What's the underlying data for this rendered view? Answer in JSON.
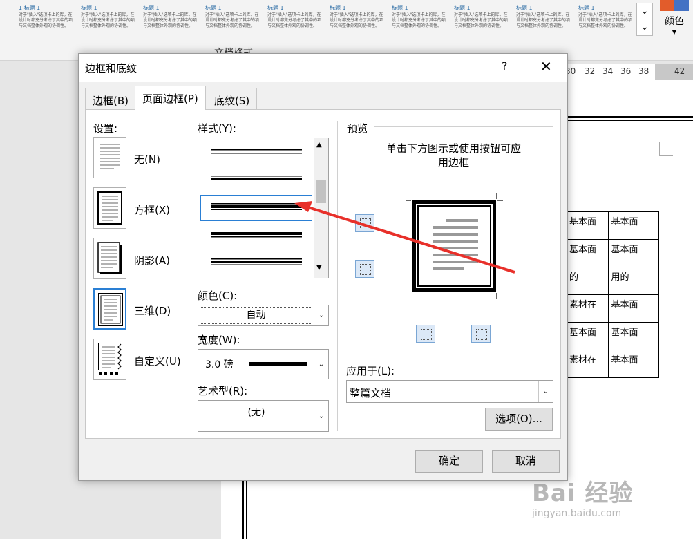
{
  "ribbon": {
    "gallery": [
      {
        "heading": "1  标题 1",
        "body": "对于\"插入\"选项卡上的库，在设计时都充分考虑了其中的项与文档整体外观的协调性。"
      },
      {
        "heading": "标题 1",
        "body": "对于\"插入\"选项卡上的库，在设计时都充分考虑了其中的项与文档整体外观的协调性。"
      },
      {
        "heading": "标题 1",
        "body": "对于\"插入\"选项卡上的库，在设计时都充分考虑了其中的项与文档整体外观的协调性。"
      },
      {
        "heading": "标题 1",
        "body": "对于\"插入\"选项卡上的库，在设计时都充分考虑了其中的项与文档整体外观的协调性。"
      },
      {
        "heading": "标题 1",
        "body": "对于\"插入\"选项卡上的库，在设计时都充分考虑了其中的项与文档整体外观的协调性。"
      },
      {
        "heading": "标题 1",
        "body": "对于\"插入\"选项卡上的库，在设计时都充分考虑了其中的项与文档整体外观的协调性。"
      },
      {
        "heading": "标题 1",
        "body": "对于\"插入\"选项卡上的库，在设计时都充分考虑了其中的项与文档整体外观的协调性。"
      },
      {
        "heading": "标题 1",
        "body": "对于\"插入\"选项卡上的库，在设计时都充分考虑了其中的项与文档整体外观的协调性。"
      },
      {
        "heading": "标题 1",
        "body": "对于\"插入\"选项卡上的库，在设计时都充分考虑了其中的项与文档整体外观的协调性。"
      },
      {
        "heading": "标题 1",
        "body": "对于\"插入\"选项卡上的库，在设计时都充分考虑了其中的项与文档整体外观的协调性。"
      }
    ],
    "group_label": "文档格式",
    "color_label": "颜色",
    "color_drop": "▼"
  },
  "ruler": {
    "ticks": [
      "30",
      "32",
      "34",
      "36",
      "38",
      "42"
    ]
  },
  "document": {
    "table": [
      [
        "基本面",
        "基本面"
      ],
      [
        "基本面",
        "基本面"
      ],
      [
        "的",
        "用的"
      ],
      [
        "素材在",
        "基本面"
      ],
      [
        "基本面",
        "基本面"
      ],
      [
        "素材在",
        "基本面"
      ]
    ]
  },
  "watermark": {
    "main": "Bai 经验",
    "sub": "jingyan.baidu.com"
  },
  "dialog": {
    "title": "边框和底纹",
    "help": "?",
    "close": "✕",
    "tabs": [
      "边框(B)",
      "页面边框(P)",
      "底纹(S)"
    ],
    "settings_label": "设置:",
    "settings": [
      "无(N)",
      "方框(X)",
      "阴影(A)",
      "三维(D)",
      "自定义(U)"
    ],
    "style_label": "样式(Y):",
    "color_label": "颜色(C):",
    "color_value": "自动",
    "width_label": "宽度(W):",
    "width_value": "3.0 磅",
    "art_label": "艺术型(R):",
    "art_value": "(无)",
    "preview_label": "预览",
    "preview_instructions": "单击下方图示或使用按钮可应用边框",
    "apply_label": "应用于(L):",
    "apply_value": "整篇文档",
    "options_button": "选项(O)...",
    "ok_button": "确定",
    "cancel_button": "取消"
  },
  "colors": {
    "accent": "#2a7fd4",
    "annotation_arrow": "#e8302a"
  }
}
